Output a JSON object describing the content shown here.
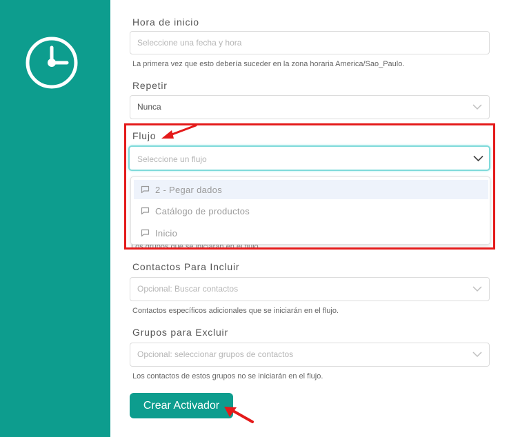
{
  "form": {
    "start_time": {
      "label": "Hora de inicio",
      "placeholder": "Seleccione una fecha y hora",
      "help": "La primera vez que esto debería suceder en la zona horaria America/Sao_Paulo."
    },
    "repeat": {
      "label": "Repetir",
      "value": "Nunca"
    },
    "flow": {
      "label": "Flujo",
      "placeholder": "Seleccione un flujo",
      "options": [
        "2 - Pegar dados",
        "Catálogo de productos",
        "Inicio"
      ],
      "highlighted_index": 0,
      "help_partial": "Los grupos que se iniciarán en el flujo"
    },
    "contacts_include": {
      "label": "Contactos Para Incluir",
      "placeholder": "Opcional: Buscar contactos",
      "help": "Contactos específicos adicionales que se iniciarán en el flujo."
    },
    "groups_exclude": {
      "label": "Grupos para Excluir",
      "placeholder": "Opcional: seleccionar grupos de contactos",
      "help": "Los contactos de estos grupos no se iniciarán en el flujo."
    },
    "submit_label": "Crear Activador"
  },
  "icons": {
    "sidebar": "clock-icon",
    "dropdown_chevron": "chevron-down-icon",
    "option": "chat-bubble-icon"
  },
  "colors": {
    "accent": "#0d9d8e",
    "annotation": "#e41a1a",
    "focus_border": "#7fdada",
    "option_highlight": "#eef3fb"
  }
}
